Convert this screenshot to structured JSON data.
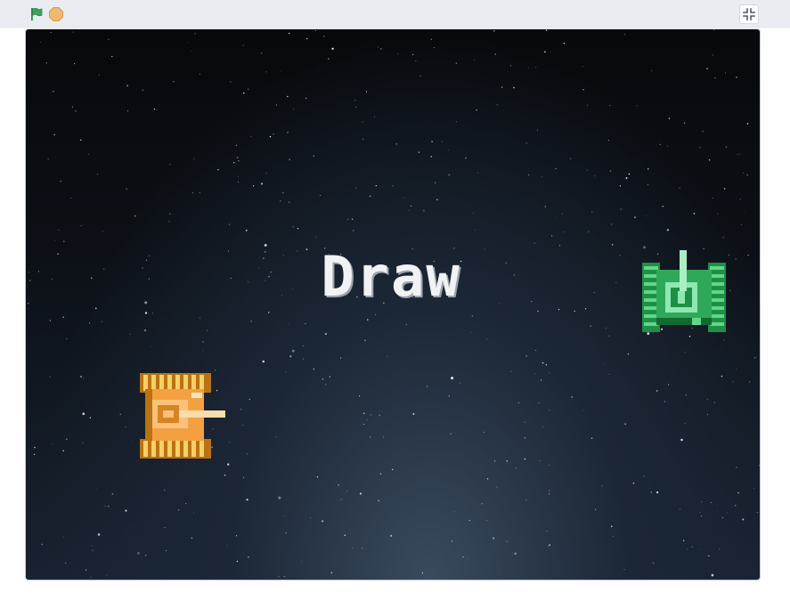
{
  "toolbar": {
    "green_flag_icon": "green-flag-icon",
    "stop_icon": "stop-icon",
    "fullscreen_icon": "exit-fullscreen-icon"
  },
  "stage": {
    "title": "Draw",
    "background": "starfield",
    "player_tank": {
      "color": "#f4a040",
      "icon": "orange-tank-icon",
      "facing": "right"
    },
    "enemy_tank": {
      "color": "#2fa85a",
      "icon": "green-tank-icon",
      "facing": "up"
    }
  },
  "colors": {
    "toolbar_bg": "#e9edf2",
    "flag_green": "#2b8a4a",
    "stop_orange": "#f0b96b",
    "text_white": "#f0f2f4"
  }
}
